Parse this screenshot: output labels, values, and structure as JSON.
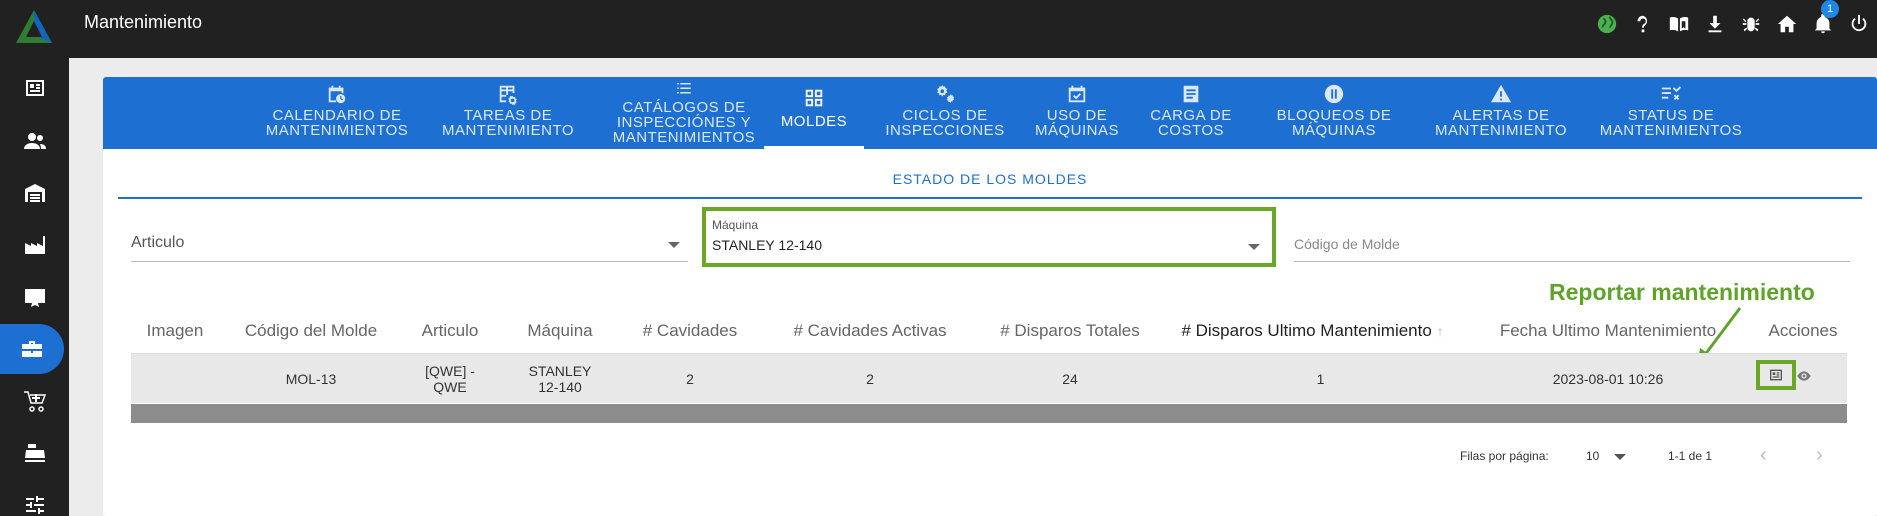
{
  "app": {
    "title": "Mantenimiento",
    "notifications_count": "1"
  },
  "top_icons": [
    "globe-icon",
    "help-icon",
    "book-icon",
    "download-icon",
    "bug-icon",
    "home-icon",
    "bell-icon",
    "power-icon"
  ],
  "sidebar": [
    "document-icon",
    "users-icon",
    "warehouse-icon",
    "factory-icon",
    "certificate-icon",
    "toolbox-icon",
    "cart-icon",
    "cash-register-icon",
    "sliders-icon"
  ],
  "tabs": [
    {
      "label": "CALENDARIO DE\nMANTENIMIENTOS"
    },
    {
      "label": "TAREAS DE\nMANTENIMIENTO"
    },
    {
      "label": "CATÁLOGOS DE\nINSPECCIÓNES Y\nMANTENIMIENTOS"
    },
    {
      "label": "MOLDES"
    },
    {
      "label": "CICLOS DE\nINSPECCIONES"
    },
    {
      "label": "USO DE\nMÁQUINAS"
    },
    {
      "label": "CARGA DE\nCOSTOS"
    },
    {
      "label": "BLOQUEOS DE\nMÁQUINAS"
    },
    {
      "label": "ALERTAS DE\nMANTENIMIENTO"
    },
    {
      "label": "STATUS DE\nMANTENIMIENTOS"
    }
  ],
  "section_title": "ESTADO DE LOS MOLDES",
  "filters": {
    "articulo_label": "Articulo",
    "maquina_label": "Máquina",
    "maquina_value": "STANLEY 12-140",
    "codigo_placeholder": "Código de Molde"
  },
  "table": {
    "headers": [
      "Imagen",
      "Código del Molde",
      "Articulo",
      "Máquina",
      "# Cavidades",
      "# Cavidades Activas",
      "# Disparos Totales",
      "# Disparos Ultimo Mantenimiento",
      "Fecha Ultimo Mantenimiento",
      "Acciones"
    ],
    "rows": [
      {
        "imagen": "",
        "codigo": "MOL-13",
        "articulo": "[QWE] -\nQWE",
        "maquina": "STANLEY\n12-140",
        "cavidades": "2",
        "cavidades_activas": "2",
        "disparos_totales": "24",
        "disparos_ultimo": "1",
        "fecha": "2023-08-01 10:26"
      }
    ]
  },
  "annotation": "Reportar mantenimiento",
  "pagination": {
    "rows_label": "Filas por página:",
    "rows_value": "10",
    "range": "1-1 de 1"
  },
  "colors": {
    "primary": "#1e6fd2",
    "highlight": "#6aa727",
    "topbar": "#212121"
  }
}
